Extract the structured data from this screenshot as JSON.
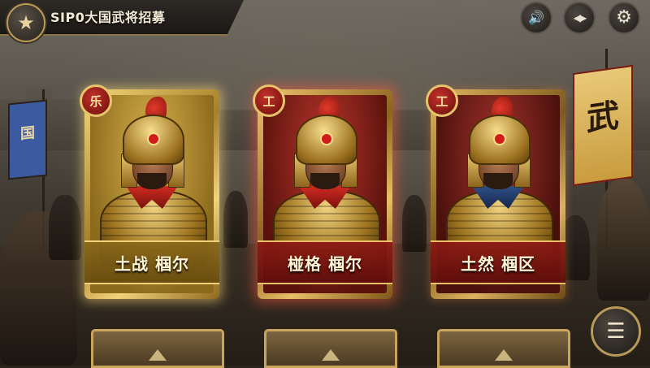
{
  "header": {
    "title": "SIP0大国武将招募",
    "star_icon": "★",
    "sound_icon": "🔊",
    "nav_icon": "◀▶",
    "settings_icon": "⚙"
  },
  "cards": [
    {
      "badge": "乐",
      "name": "土战 椢尔",
      "rarity": "gold"
    },
    {
      "badge": "工",
      "name": "椪格 椢尔",
      "rarity": "red"
    },
    {
      "badge": "工",
      "name": "土然 椢区",
      "rarity": "darkred"
    }
  ],
  "banners": {
    "left_glyph": "国",
    "right_glyph": "武"
  },
  "menu": {
    "icon": "☰"
  },
  "colors": {
    "gold_frame": "#f1d27a",
    "red_card": "#b8372b",
    "highlight_glow": "#ff5a3c"
  }
}
